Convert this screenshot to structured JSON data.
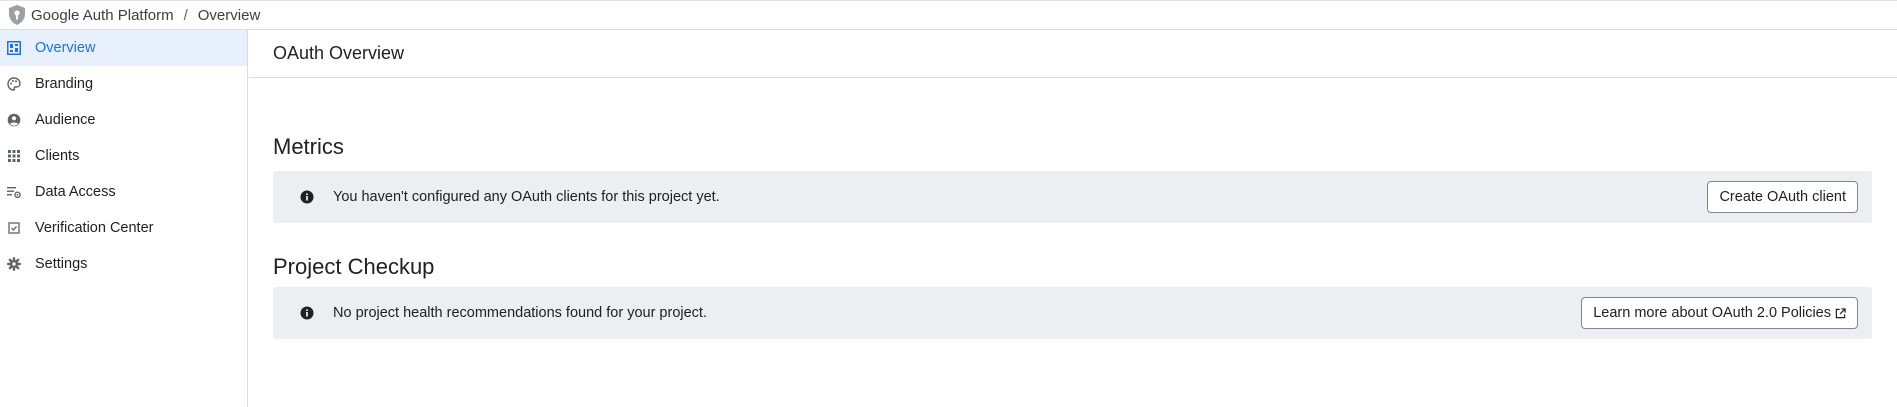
{
  "header": {
    "breadcrumb_root": "Google Auth Platform",
    "breadcrumb_separator": "/",
    "breadcrumb_current": "Overview",
    "logo_icon": "shield-key-icon"
  },
  "sidebar": {
    "items": [
      {
        "label": "Overview",
        "icon": "dashboard-icon",
        "active": true
      },
      {
        "label": "Branding",
        "icon": "palette-icon",
        "active": false
      },
      {
        "label": "Audience",
        "icon": "account-circle-icon",
        "active": false
      },
      {
        "label": "Clients",
        "icon": "apps-grid-icon",
        "active": false
      },
      {
        "label": "Data Access",
        "icon": "filter-settings-icon",
        "active": false
      },
      {
        "label": "Verification Center",
        "icon": "checkbox-icon",
        "active": false
      },
      {
        "label": "Settings",
        "icon": "gear-icon",
        "active": false
      }
    ]
  },
  "main": {
    "page_title": "OAuth Overview",
    "metrics": {
      "title": "Metrics",
      "notice_text": "You haven't configured any OAuth clients for this project yet.",
      "button_label": "Create OAuth client"
    },
    "checkup": {
      "title": "Project Checkup",
      "notice_text": "No project health recommendations found for your project.",
      "button_label": "Learn more about OAuth 2.0 Policies"
    }
  },
  "colors": {
    "accent": "#1a73e8",
    "active_bg": "#e8f0fe",
    "notice_bg": "#eceef1",
    "border": "#dadce0"
  }
}
